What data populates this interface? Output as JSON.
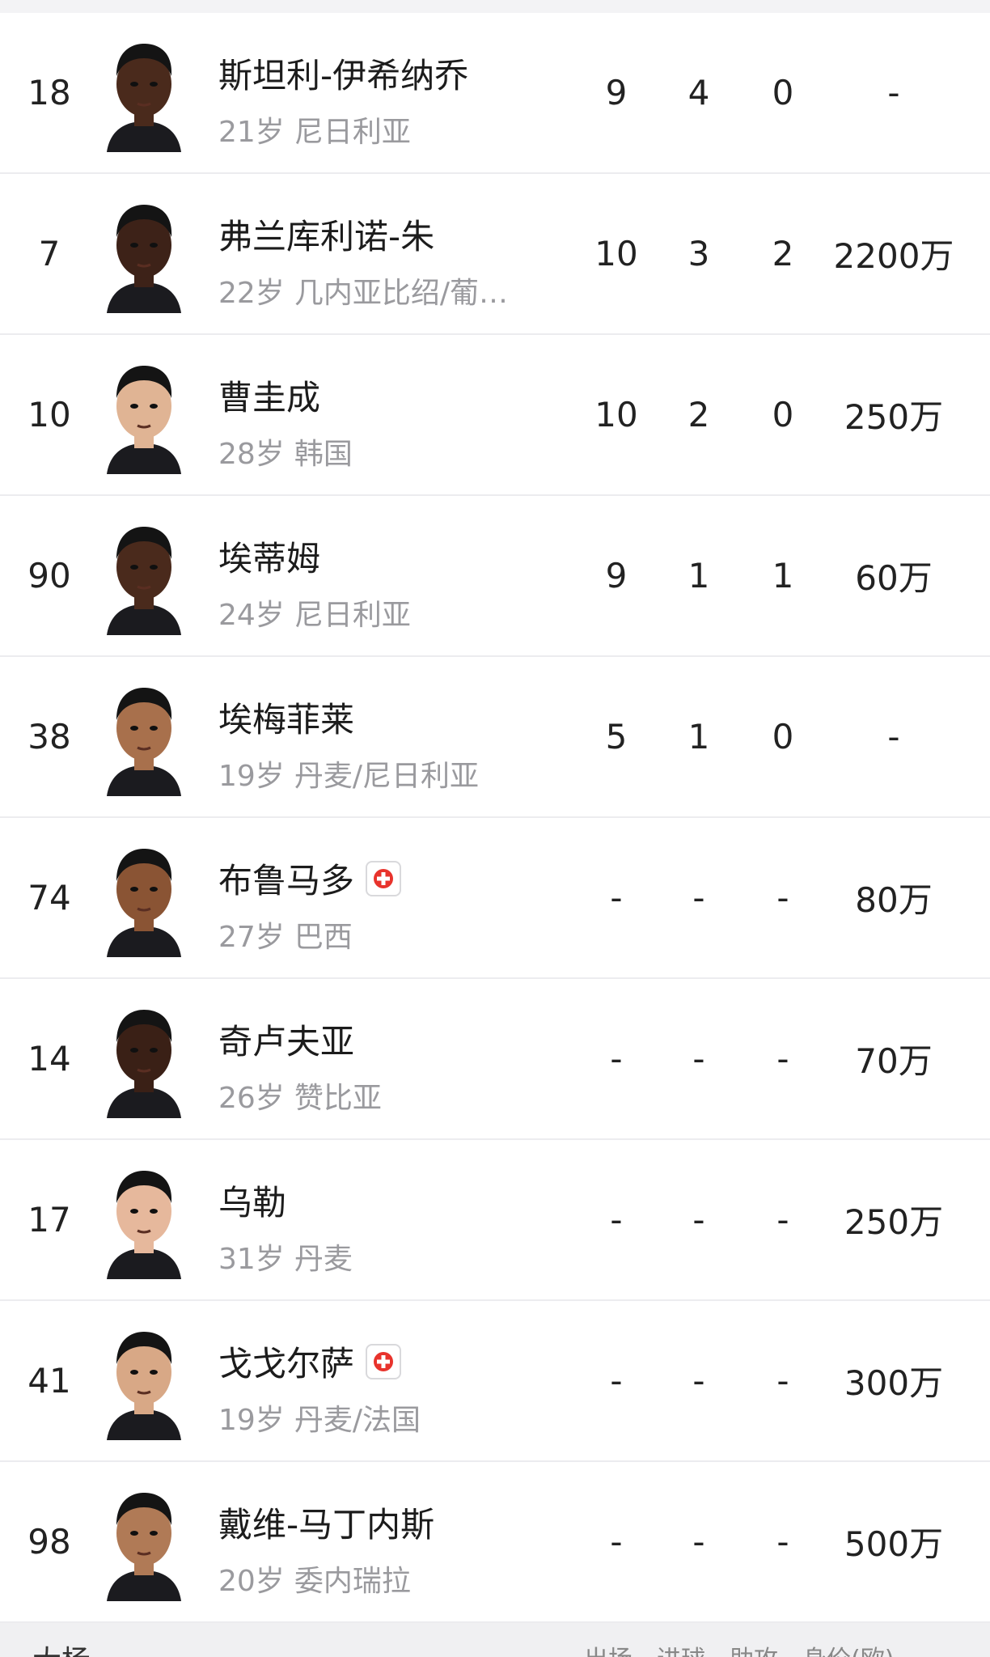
{
  "players": [
    {
      "number": "18",
      "name": "斯坦利-伊希纳乔",
      "age": "21岁",
      "nationality": "尼日利亚",
      "apps": "9",
      "goals": "4",
      "assists": "0",
      "value": "-",
      "injured": false,
      "skin": "#4a2a1c"
    },
    {
      "number": "7",
      "name": "弗兰库利诺-朱",
      "age": "22岁",
      "nationality": "几内亚比绍/葡…",
      "apps": "10",
      "goals": "3",
      "assists": "2",
      "value": "2200万",
      "injured": false,
      "skin": "#3d2218"
    },
    {
      "number": "10",
      "name": "曹圭成",
      "age": "28岁",
      "nationality": "韩国",
      "apps": "10",
      "goals": "2",
      "assists": "0",
      "value": "250万",
      "injured": false,
      "skin": "#e0b494"
    },
    {
      "number": "90",
      "name": "埃蒂姆",
      "age": "24岁",
      "nationality": "尼日利亚",
      "apps": "9",
      "goals": "1",
      "assists": "1",
      "value": "60万",
      "injured": false,
      "skin": "#4a2a1c"
    },
    {
      "number": "38",
      "name": "埃梅菲莱",
      "age": "19岁",
      "nationality": "丹麦/尼日利亚",
      "apps": "5",
      "goals": "1",
      "assists": "0",
      "value": "-",
      "injured": false,
      "skin": "#a8704c"
    },
    {
      "number": "74",
      "name": "布鲁马多",
      "age": "27岁",
      "nationality": "巴西",
      "apps": "-",
      "goals": "-",
      "assists": "-",
      "value": "80万",
      "injured": true,
      "skin": "#8a5434"
    },
    {
      "number": "14",
      "name": "奇卢夫亚",
      "age": "26岁",
      "nationality": "赞比亚",
      "apps": "-",
      "goals": "-",
      "assists": "-",
      "value": "70万",
      "injured": false,
      "skin": "#3a2016"
    },
    {
      "number": "17",
      "name": "乌勒",
      "age": "31岁",
      "nationality": "丹麦",
      "apps": "-",
      "goals": "-",
      "assists": "-",
      "value": "250万",
      "injured": false,
      "skin": "#e6b89c"
    },
    {
      "number": "41",
      "name": "戈戈尔萨",
      "age": "19岁",
      "nationality": "丹麦/法国",
      "apps": "-",
      "goals": "-",
      "assists": "-",
      "value": "300万",
      "injured": true,
      "skin": "#d8a886"
    },
    {
      "number": "98",
      "name": "戴维-马丁内斯",
      "age": "20岁",
      "nationality": "委内瑞拉",
      "apps": "-",
      "goals": "-",
      "assists": "-",
      "value": "500万",
      "injured": false,
      "skin": "#b07a56"
    }
  ],
  "footer": {
    "label": "大杨",
    "columns": [
      "出场",
      "进球",
      "助攻",
      "身价(欧)"
    ]
  },
  "colors": {
    "divider": "#ececef",
    "meta_text": "#9a9a9e",
    "injury_cross": "#e8332c"
  }
}
